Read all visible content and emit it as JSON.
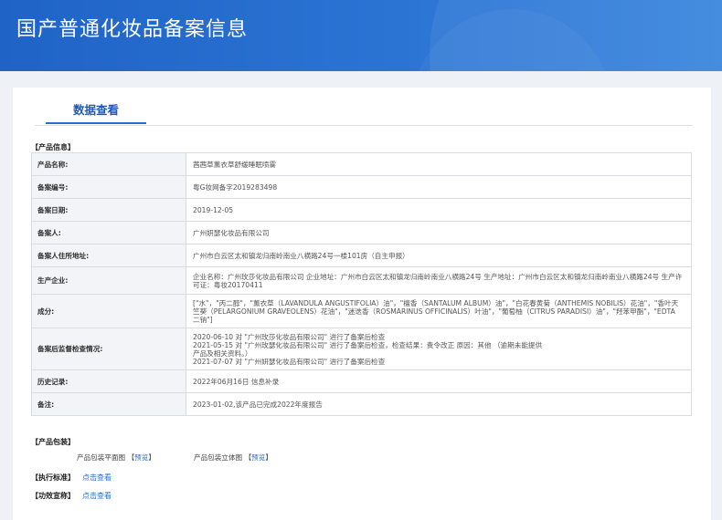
{
  "banner": {
    "title": "国产普通化妆品备案信息"
  },
  "tabs": [
    {
      "label": "数据查看"
    }
  ],
  "product_info": {
    "section_title": "【产品信息】",
    "rows": [
      {
        "label": "产品名称:",
        "value": "茜茜草薰衣草舒缓睡眠喷雾"
      },
      {
        "label": "备案编号:",
        "value": "粤G妆网备字2019283498"
      },
      {
        "label": "备案日期:",
        "value": "2019-12-05"
      },
      {
        "label": "备案人:",
        "value": "广州妍瑟化妆品有限公司"
      },
      {
        "label": "备案人住所地址:",
        "value": "广州市白云区太和镇龙归南岭南业八横路24号一楼101房（自主申报）"
      },
      {
        "label": "生产企业:",
        "value": "企业名称：广州玫莎化妆品有限公司 企业地址：广州市白云区太和镇龙归南岭南业八横路24号 生产地址：广州市白云区太和镇龙归南岭南业八横路24号 生产许可证：粤妆20170411"
      },
      {
        "label": "成分:",
        "value": "[\"水\"，\"丙二醇\"，\"薰衣草（LAVANDULA ANGUSTIFOLIA）油\"，\"檀香（SANTALUM ALBUM）油\"，\"白花春黄菊（ANTHEMIS NOBILIS）花油\"，\"香叶天竺葵（PELARGONIUM GRAVEOLENS）花油\"，\"迷迭香（ROSMARINUS OFFICINALIS）叶油\"，\"葡萄柚（CITRUS PARADISI）油\"，\"羟苯甲酯\"，\"EDTA 二钠\"]"
      },
      {
        "label": "备案后监督检查情况:",
        "lines": [
          "2020-06-10 对 \"广州玫莎化妆品有限公司\" 进行了备案后检查",
          "2021-05-15 对 \"广州玫瑟化妆品有限公司\" 进行了备案后检查，检查结果：责令改正 原因：其他 （逾期未能提供",
          "产品及相关资料。）",
          "2021-07-07 对 \"广州妍瑟化妆品有限公司\" 进行了备案后检查"
        ]
      },
      {
        "label": "历史记录:",
        "value": "2022年06月16日 信息补录"
      },
      {
        "label": "备注:",
        "value": "2023-01-02,该产品已完成2022年度报告"
      }
    ]
  },
  "packaging": {
    "section_title": "【产品包装】",
    "items": [
      {
        "label": "产品包装平面图",
        "bracket_open": "【",
        "link": "预览",
        "bracket_close": "】"
      },
      {
        "label": "产品包装立体图",
        "bracket_open": "【",
        "link": "预览",
        "bracket_close": "】"
      }
    ]
  },
  "standards": {
    "label": "【执行标准】",
    "link": "点击查看"
  },
  "claims": {
    "label": "【功效宣称】",
    "link": "点击查看"
  }
}
